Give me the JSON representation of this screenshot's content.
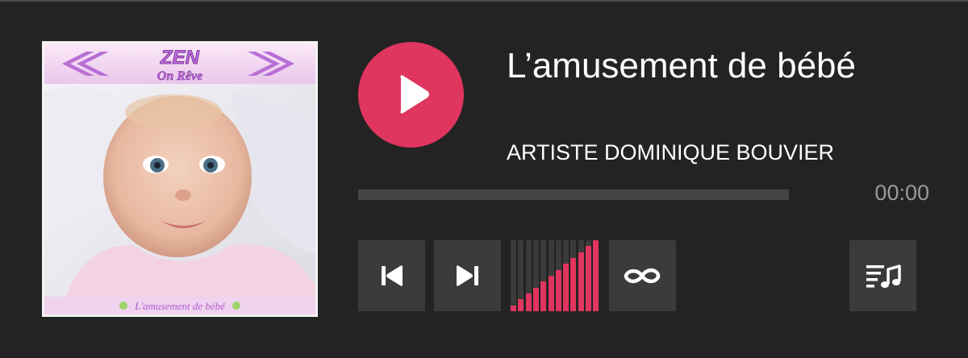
{
  "cover": {
    "header_brand_top": "ZEN",
    "header_brand_bottom": "On Rêve",
    "footer_caption": "L'amusement de bébé"
  },
  "track": {
    "title": "L’amusement de bébé",
    "artist": "ARTISTE DOMINIQUE BOUVIER",
    "time": "00:00",
    "progress": 0
  },
  "controls": {
    "play_icon": "play-icon",
    "prev_icon": "skip-previous-icon",
    "next_icon": "skip-next-icon",
    "repeat_icon": "repeat-icon",
    "playlist_icon": "playlist-music-icon"
  },
  "volume": {
    "level": 1.0,
    "bar_count": 12
  },
  "colors": {
    "accent": "#e0355e",
    "background": "#232323",
    "button": "#3b3b3b",
    "track_bg": "#444444",
    "time_text": "#9b9b9b"
  }
}
